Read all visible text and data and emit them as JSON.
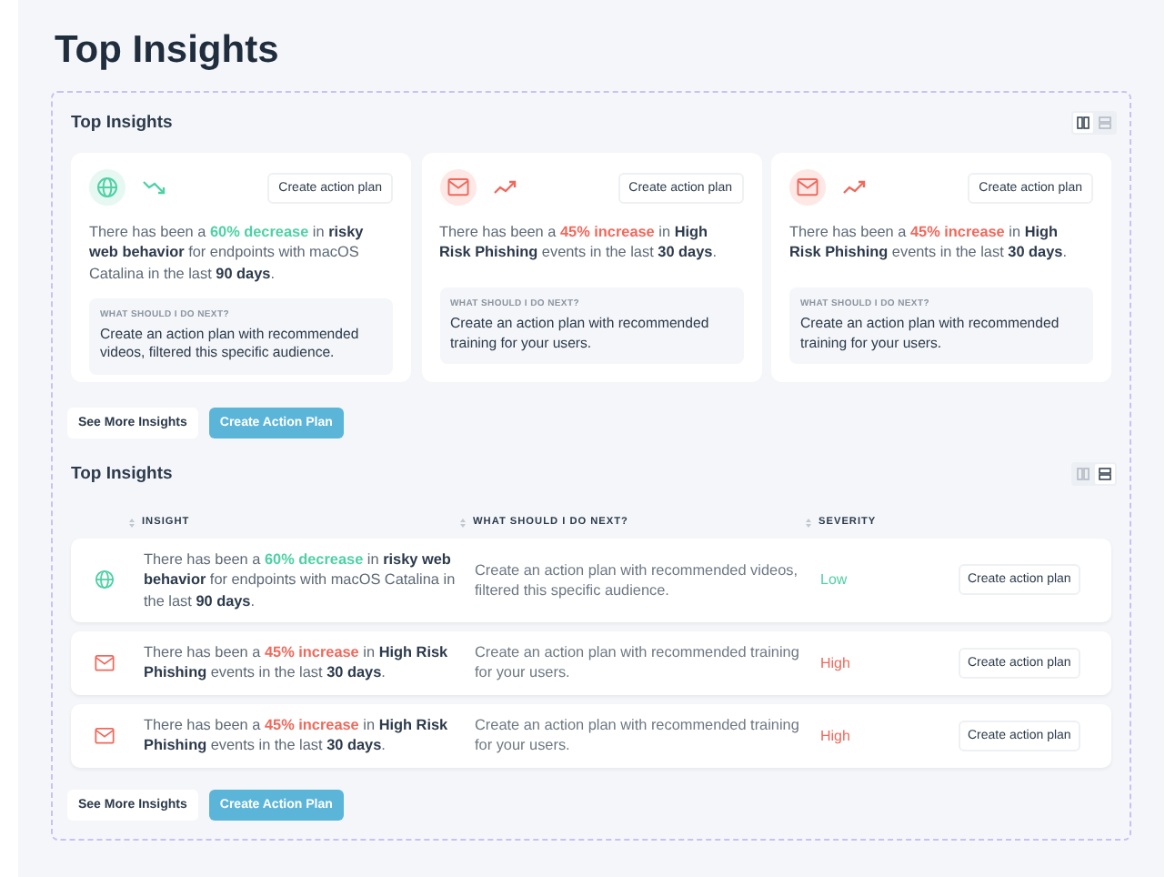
{
  "page_title": "Top Insights",
  "grid_section": {
    "title": "Top Insights",
    "views": [
      {
        "kind": "grid",
        "selected": true
      },
      {
        "kind": "list",
        "selected": false
      }
    ],
    "cards": [
      {
        "kind": "web",
        "rising": false,
        "action": "Create action plan",
        "lead": "There has been a ",
        "change": "60% decrease",
        "rest": " in **risky web behavior** for endpoints with macOS Catalina in the last **90 days**.",
        "next_label": "WHAT SHOULD I DO NEXT?",
        "next": "Create an action plan with recommended videos, filtered this specific audience."
      },
      {
        "kind": "mail",
        "rising": true,
        "action": "Create action plan",
        "lead": "There has been a ",
        "change": "45% increase",
        "rest": " in **High Risk Phishing** events in the last **30 days**.",
        "next_label": "WHAT SHOULD I DO NEXT?",
        "next": "Create an action plan with recommended training for your users."
      },
      {
        "kind": "mail",
        "rising": true,
        "action": "Create action plan",
        "lead": "There has been a ",
        "change": "45% increase",
        "rest": " in **High Risk Phishing** events in the last **30 days**.",
        "next_label": "WHAT SHOULD I DO NEXT?",
        "next": "Create an action plan with recommended training for your users."
      }
    ],
    "buttons": [
      "See More Insights",
      "Create Action Plan"
    ]
  },
  "table_section": {
    "title": "Top Insights",
    "views": [
      {
        "kind": "grid",
        "selected": false
      },
      {
        "kind": "list",
        "selected": true
      }
    ],
    "columns": [
      "INSIGHT",
      "WHAT SHOULD I DO NEXT?",
      "SEVERITY"
    ],
    "rows": [
      {
        "kind": "web",
        "rising": false,
        "lead": "There has been a ",
        "change": "60% decrease",
        "rest": " in **risky web behavior** for endpoints with macOS Catalina in the last **90 days**.",
        "next": "Create an action plan with recommended videos, filtered this specific audience.",
        "severity": "Low",
        "action": "Create action plan"
      },
      {
        "kind": "mail",
        "rising": true,
        "lead": "There has been a ",
        "change": "45% increase",
        "rest": " in **High Risk Phishing** events in the last **30 days**.",
        "next": "Create an action plan with recommended training for your users.",
        "severity": "High",
        "action": "Create action plan"
      },
      {
        "kind": "mail",
        "rising": true,
        "lead": "There has been a ",
        "change": "45% increase",
        "rest": " in **High Risk Phishing** events in the last **30 days**.",
        "next": "Create an action plan with recommended training for your users.",
        "severity": "High",
        "action": "Create action plan"
      }
    ],
    "buttons": [
      "See More Insights",
      "Create Action Plan"
    ]
  }
}
